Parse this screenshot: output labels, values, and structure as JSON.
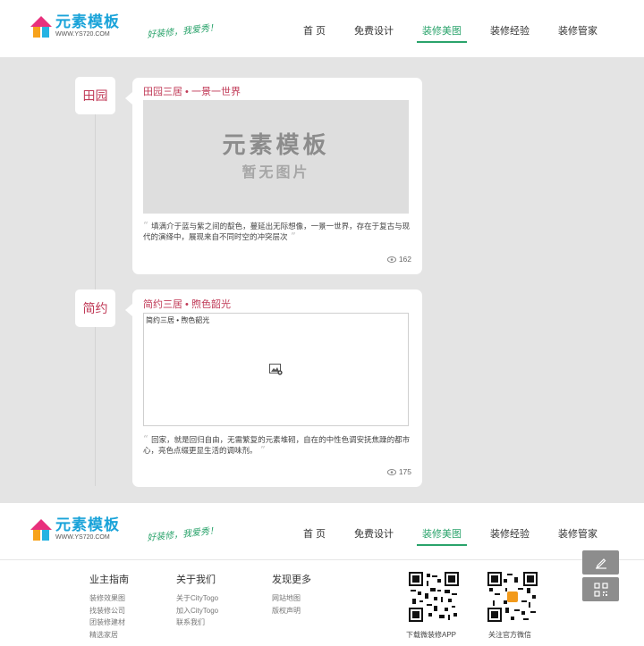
{
  "header": {
    "logo_cn": "元素模板",
    "logo_en": "WWW.YS720.COM",
    "slogan": "好装修，我爱秀！",
    "nav": [
      "首 页",
      "免费设计",
      "装修美图",
      "装修经验",
      "装修管家"
    ],
    "active_nav": "装修美图"
  },
  "timeline": [
    {
      "tag": "田园",
      "title": "田园三居 • 一景一世界",
      "image_watermark_1": "元素模板",
      "image_watermark_2": "暂无图片",
      "description": "填满介于蓝与紫之间的靛色，蔓延出无际想像，一景一世界，存在于复古与现代的演绎中，展现来自不同时空的冲突层次",
      "views": "162"
    },
    {
      "tag": "简约",
      "title": "简约三居 • 煦色韶光",
      "image_alt": "简约三居 • 煦色韶光",
      "description": "回家，就是回归自由，无需繁复的元素堆砌，自在的中性色调安抚焦躁的都市心，亮色点缀更显生活的调味剂。",
      "views": "175"
    }
  ],
  "footer": {
    "columns": [
      {
        "heading": "业主指南",
        "links": [
          "装修效果图",
          "找装修公司",
          "团装修建材",
          "精选家居"
        ]
      },
      {
        "heading": "关于我们",
        "links": [
          "关于CityTogo",
          "加入CityTogo",
          "联系我们"
        ]
      },
      {
        "heading": "发现更多",
        "links": [
          "网站地图",
          "版权声明"
        ]
      }
    ],
    "qr": [
      {
        "caption": "下载微装修APP"
      },
      {
        "caption": "关注官方微信"
      }
    ]
  },
  "colors": {
    "accent_green": "#2aa36b",
    "accent_red": "#c03a57",
    "logo_blue": "#1aa3d9",
    "background_gray": "#e4e4e4"
  },
  "icons": [
    "eye-icon",
    "broken-image-icon",
    "edit-icon",
    "qr-code-icon"
  ]
}
